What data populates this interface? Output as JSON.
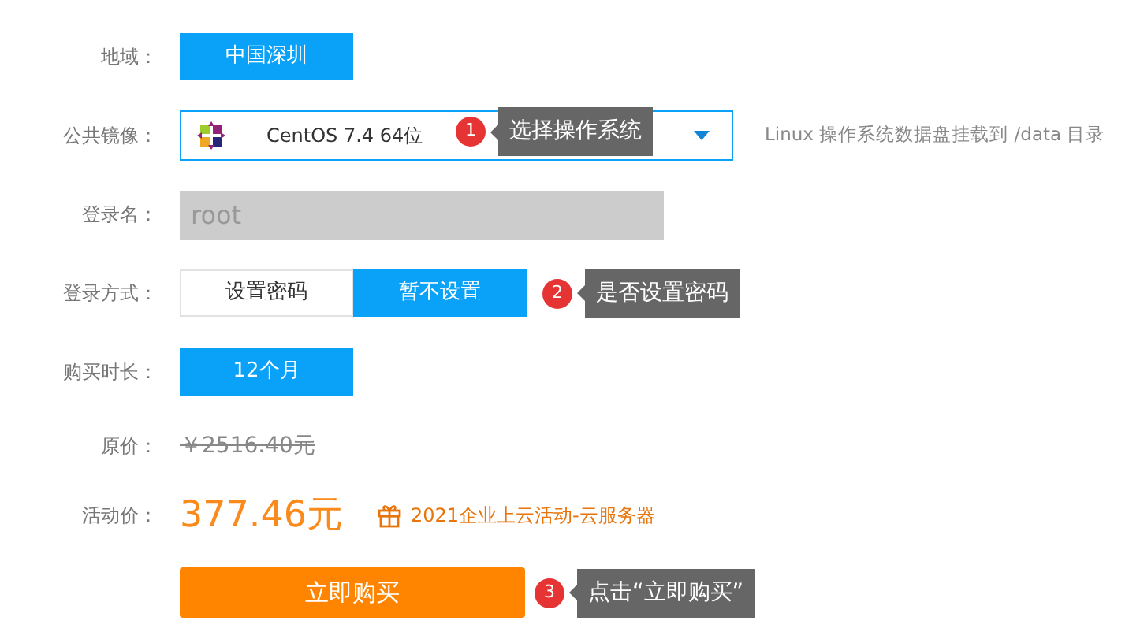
{
  "region": {
    "label": "地域：",
    "options": [
      {
        "label": "中国深圳",
        "selected": true
      }
    ]
  },
  "image": {
    "label": "公共镜像：",
    "value": "CentOS 7.4 64位",
    "hint": "Linux 操作系统数据盘挂载到 /data 目录",
    "callout": {
      "number": "1",
      "text": "选择操作系统"
    }
  },
  "login_name": {
    "label": "登录名：",
    "value": "root",
    "disabled": true
  },
  "login_method": {
    "label": "登录方式：",
    "options": [
      {
        "label": "设置密码",
        "selected": false
      },
      {
        "label": "暂不设置",
        "selected": true
      }
    ],
    "callout": {
      "number": "2",
      "text": "是否设置密码"
    }
  },
  "duration": {
    "label": "购买时长：",
    "options": [
      {
        "label": "12个月",
        "selected": true
      }
    ]
  },
  "original_price": {
    "label": "原价：",
    "value": "￥2516.40元"
  },
  "sale_price": {
    "label": "活动价：",
    "value": "377.46元",
    "promo": "2021企业上云活动-云服务器"
  },
  "buy": {
    "label": "立即购买",
    "callout": {
      "number": "3",
      "text": "点击“立即购买”"
    }
  }
}
